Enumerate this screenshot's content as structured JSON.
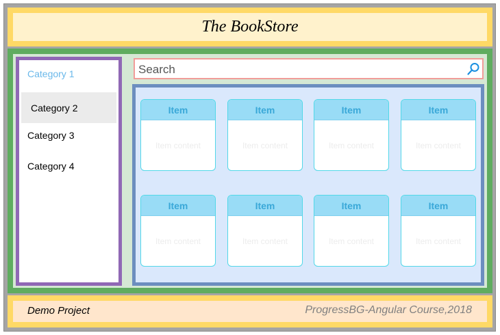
{
  "header": {
    "title": "The BookStore"
  },
  "sidebar": {
    "categories": [
      {
        "label": "Category 1",
        "state": "active"
      },
      {
        "label": "Category 2",
        "state": "hover"
      },
      {
        "label": "Category 3",
        "state": "normal"
      },
      {
        "label": "Category 4",
        "state": "normal"
      }
    ]
  },
  "search": {
    "placeholder": "Search",
    "icon": "search-icon"
  },
  "items": [
    {
      "title": "Item",
      "content": "Item content"
    },
    {
      "title": "Item",
      "content": "Item content"
    },
    {
      "title": "Item",
      "content": "Item content"
    },
    {
      "title": "Item",
      "content": "Item content"
    },
    {
      "title": "Item",
      "content": "Item content"
    },
    {
      "title": "Item",
      "content": "Item content"
    },
    {
      "title": "Item",
      "content": "Item content"
    },
    {
      "title": "Item",
      "content": "Item content"
    }
  ],
  "footer": {
    "left": "Demo Project",
    "right": "ProgressBG-Angular Course,2018"
  },
  "colors": {
    "header": "#ffd966",
    "main": "#5fac5f",
    "sidebar_border": "#9068b5",
    "items_border": "#6c8ebf",
    "active_category": "#6ab8ea"
  }
}
